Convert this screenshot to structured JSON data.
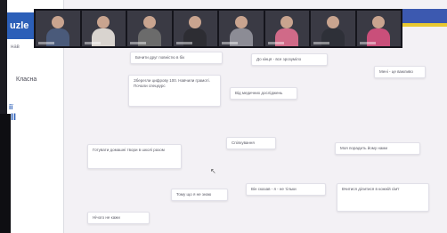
{
  "sidebar": {
    "brand": "uzle",
    "item_1": "нав",
    "item_2": "Класна",
    "item_3": "ії",
    "item_3b": "ІІ"
  },
  "video_tiles": [
    {
      "shirt": "#4a5a7a"
    },
    {
      "shirt": "#d9d4cf"
    },
    {
      "shirt": "#6b6b6b"
    },
    {
      "shirt": "#2d2d33"
    },
    {
      "shirt": "#8c8c95"
    },
    {
      "shirt": "#d06a88"
    },
    {
      "shirt": "#2e3038"
    },
    {
      "shirt": "#c94f7a"
    }
  ],
  "colors": {
    "brand_blue": "#2c5fb8",
    "flag_blue": "#3c59b0",
    "flag_yellow": "#e8c830"
  },
  "notes": [
    "Бачити друг повністю в бік",
    "До кінця - все зрозуміло",
    "Мені - це важливо",
    "Зберегли цифрову 100. Навчили грамоті. Почали спецкурс",
    "Від медичних досліджень",
    "Готувати домашні твори в школі разом",
    "Спілкування",
    "Моя порадить йому нами",
    "Тому що я не знаю",
    "Він сказав - я - не тільки",
    "Вчитися ділитися в кожній сім'ї",
    "Нічого не кажи"
  ]
}
